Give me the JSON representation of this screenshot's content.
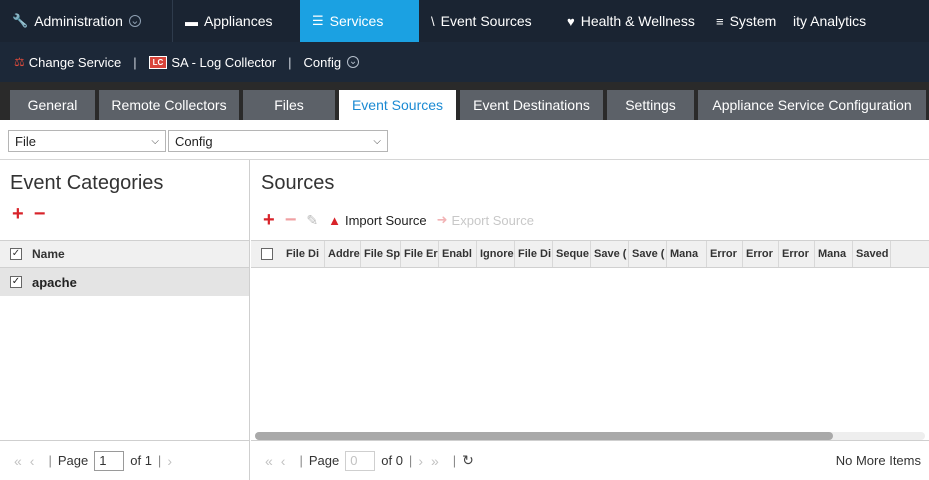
{
  "topnav": {
    "administration": "Administration",
    "appliances": "Appliances",
    "services": "Services",
    "event_sources": "Event Sources",
    "health": "Health & Wellness",
    "system": "System",
    "analytics": "ity Analytics"
  },
  "service_bar": {
    "change_service": "Change Service",
    "badge": "LC",
    "service_name": "SA - Log Collector",
    "config": "Config"
  },
  "tabs": [
    {
      "label": "General"
    },
    {
      "label": "Remote Collectors"
    },
    {
      "label": "Files"
    },
    {
      "label": "Event Sources"
    },
    {
      "label": "Event Destinations"
    },
    {
      "label": "Settings"
    },
    {
      "label": "Appliance Service Configuration"
    }
  ],
  "filters": {
    "type_selected": "File",
    "mode_selected": "Config"
  },
  "left_panel": {
    "title": "Event Categories",
    "add": "+",
    "remove": "−",
    "column_name": "Name",
    "rows": [
      {
        "name": "apache",
        "checked": true
      }
    ]
  },
  "right_panel": {
    "title": "Sources",
    "add": "+",
    "remove": "−",
    "import_label": "Import Source",
    "export_label": "Export Source",
    "columns": [
      "File Di",
      "Addre",
      "File Sp",
      "File Er",
      "Enabl",
      "Ignore",
      "File Di",
      "Seque",
      "Save (",
      "Save (",
      "Mana",
      "Error",
      "Error",
      "Error",
      "Mana",
      "Saved"
    ]
  },
  "pager_left": {
    "page_label": "Page",
    "page_value": "1",
    "of_label": "of 1"
  },
  "pager_right": {
    "page_label": "Page",
    "page_value": "0",
    "of_label": "of 0",
    "status": "No More Items"
  },
  "colors": {
    "nav_bg": "#1a2432",
    "nav_active": "#1ba1e2",
    "tab_active_text": "#1b8ad3",
    "accent_red": "#d8232a"
  }
}
